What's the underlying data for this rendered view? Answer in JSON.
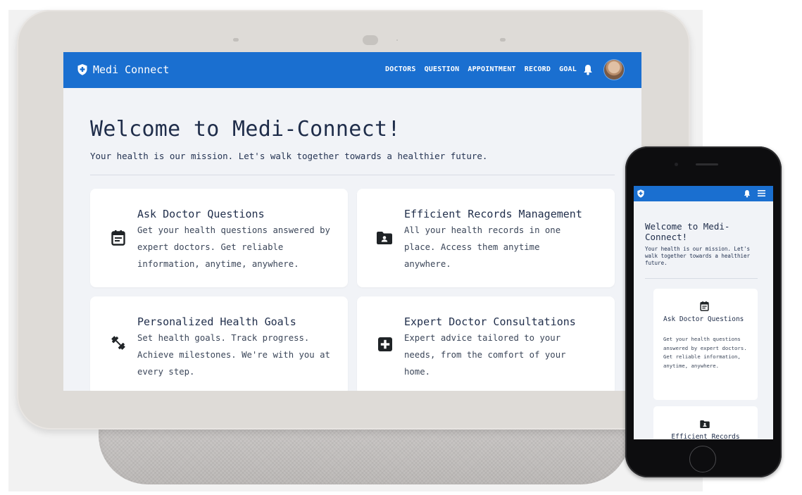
{
  "app": {
    "name": "Medi Connect"
  },
  "nav": {
    "links": [
      "DOCTORS",
      "QUESTION",
      "APPOINTMENT",
      "RECORD",
      "GOAL"
    ],
    "icons": [
      "shield-plus-icon",
      "bell-icon",
      "avatar"
    ]
  },
  "hero": {
    "title": "Welcome to Medi-Connect!",
    "subtitle": "Your health is our mission. Let's walk together towards a healthier future."
  },
  "cards": [
    {
      "icon": "calendar-note-icon",
      "title": "Ask Doctor Questions",
      "text": "Get your health questions answered by expert doctors. Get reliable information, anytime, anywhere."
    },
    {
      "icon": "folder-user-icon",
      "title": "Efficient Records Management",
      "text": "All your health records in one place. Access them anytime anywhere."
    },
    {
      "icon": "dumbbell-icon",
      "title": "Personalized Health Goals",
      "text": "Set health goals. Track progress. Achieve milestones. We're with you at every step."
    },
    {
      "icon": "medical-plus-icon",
      "title": "Expert Doctor Consultations",
      "text": "Expert advice tailored to your needs, from the comfort of your home."
    }
  ],
  "mobile": {
    "title": "Welcome to Medi-Connect!",
    "subtitle": "Your health is our mission. Let's walk together towards a healthier future.",
    "cards": [
      {
        "title": "Ask Doctor Questions",
        "text": "Get your health questions answered by expert doctors. Get reliable information, anytime, anywhere."
      },
      {
        "title": "Efficient Records"
      }
    ]
  },
  "colors": {
    "primary": "#1a6fd0",
    "background": "#f1f3f7",
    "text": "#1f2d4a"
  }
}
